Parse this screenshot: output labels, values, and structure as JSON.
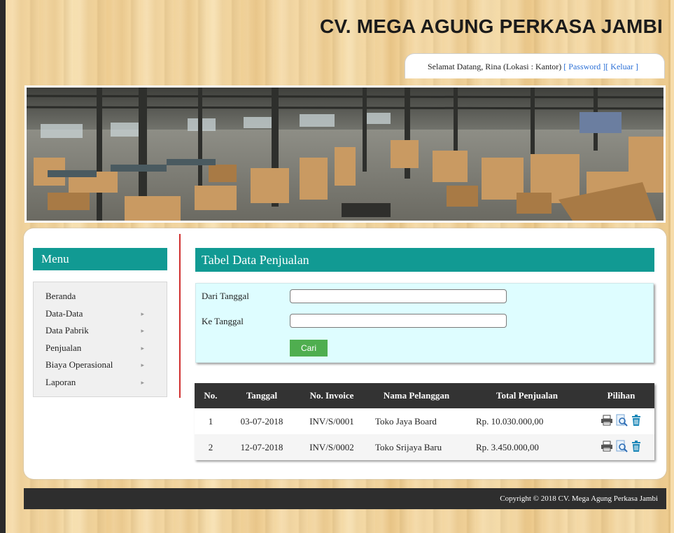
{
  "header": {
    "site_title": "CV. MEGA AGUNG PERKASA JAMBI",
    "welcome_text": "Selamat Datang, Rina (Lokasi : Kantor)",
    "password_link": "[ Password ]",
    "logout_link": "[ Keluar ]"
  },
  "sidebar": {
    "title": "Menu",
    "items": [
      {
        "label": "Beranda",
        "has_submenu": false
      },
      {
        "label": "Data-Data",
        "has_submenu": true
      },
      {
        "label": "Data Pabrik",
        "has_submenu": true
      },
      {
        "label": "Penjualan",
        "has_submenu": true
      },
      {
        "label": "Biaya Operasional",
        "has_submenu": true
      },
      {
        "label": "Laporan",
        "has_submenu": true
      }
    ],
    "submenu_arrow": "▸"
  },
  "main": {
    "panel_title": "Tabel Data Penjualan",
    "filter": {
      "from_label": "Dari Tanggal",
      "from_value": "",
      "to_label": "Ke Tanggal",
      "to_value": "",
      "search_button": "Cari"
    },
    "table": {
      "headers": [
        "No.",
        "Tanggal",
        "No. Invoice",
        "Nama Pelanggan",
        "Total Penjualan",
        "Pilihan"
      ],
      "rows": [
        {
          "no": "1",
          "tanggal": "03-07-2018",
          "invoice": "INV/S/0001",
          "pelanggan": "Toko Jaya Board",
          "total": "Rp. 10.030.000,00"
        },
        {
          "no": "2",
          "tanggal": "12-07-2018",
          "invoice": "INV/S/0002",
          "pelanggan": "Toko Srijaya Baru",
          "total": "Rp. 3.450.000,00"
        }
      ],
      "row_actions": [
        "print-icon",
        "view-icon",
        "delete-icon"
      ]
    }
  },
  "footer": {
    "copyright": "Copyright © 2018 CV. Mega Agung Perkasa Jambi"
  },
  "colors": {
    "accent_teal": "#119a93",
    "filter_bg": "#defdff",
    "button_green": "#4fae4f",
    "table_header": "#333333",
    "link_blue": "#2a6fd6",
    "divider_red": "#d03030"
  }
}
